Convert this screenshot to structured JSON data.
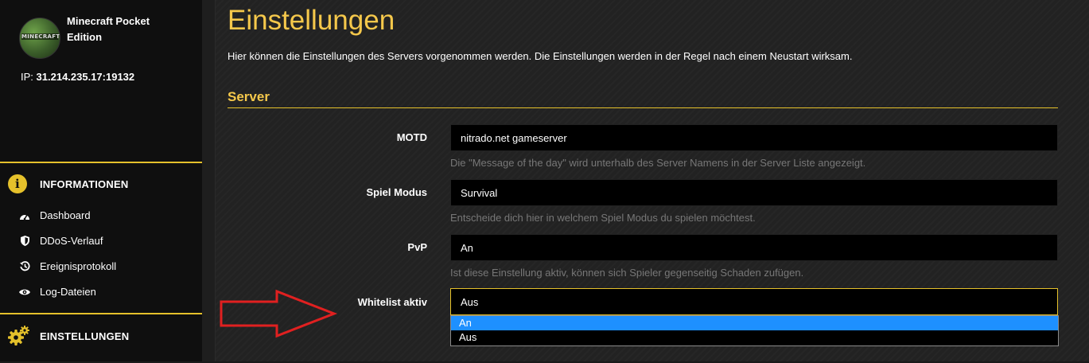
{
  "sidebar": {
    "server_name": "Minecraft Pocket Edition",
    "logo_text": "MINECRAFT",
    "ip_label": "IP:",
    "ip_value": "31.214.235.17:19132",
    "info_section": {
      "title": "INFORMATIONEN",
      "items": [
        {
          "label": "Dashboard",
          "icon": "dashboard-icon"
        },
        {
          "label": "DDoS-Verlauf",
          "icon": "shield-icon"
        },
        {
          "label": "Ereignisprotokoll",
          "icon": "history-icon"
        },
        {
          "label": "Log-Dateien",
          "icon": "eye-icon"
        }
      ]
    },
    "settings_section": {
      "title": "EINSTELLUNGEN",
      "icon": "gears-icon"
    }
  },
  "main": {
    "title": "Einstellungen",
    "description": "Hier können die Einstellungen des Servers vorgenommen werden. Die Einstellungen werden in der Regel nach einem Neustart wirksam.",
    "section_title": "Server",
    "fields": [
      {
        "label": "MOTD",
        "value": "nitrado.net gameserver",
        "help": "Die \"Message of the day\" wird unterhalb des Server Namens in der Server Liste angezeigt."
      },
      {
        "label": "Spiel Modus",
        "value": "Survival",
        "help": "Entscheide dich hier in welchem Spiel Modus du spielen möchtest."
      },
      {
        "label": "PvP",
        "value": "An",
        "help": "Ist diese Einstellung aktiv, können sich Spieler gegenseitig Schaden zufügen."
      },
      {
        "label": "Whitelist aktiv",
        "value": "Aus"
      }
    ],
    "dropdown_options": [
      "An",
      "Aus"
    ]
  },
  "colors": {
    "accent": "#e5c12b",
    "title": "#f5c84b",
    "highlight": "#1e90ff",
    "annotation_arrow": "#e02020"
  }
}
